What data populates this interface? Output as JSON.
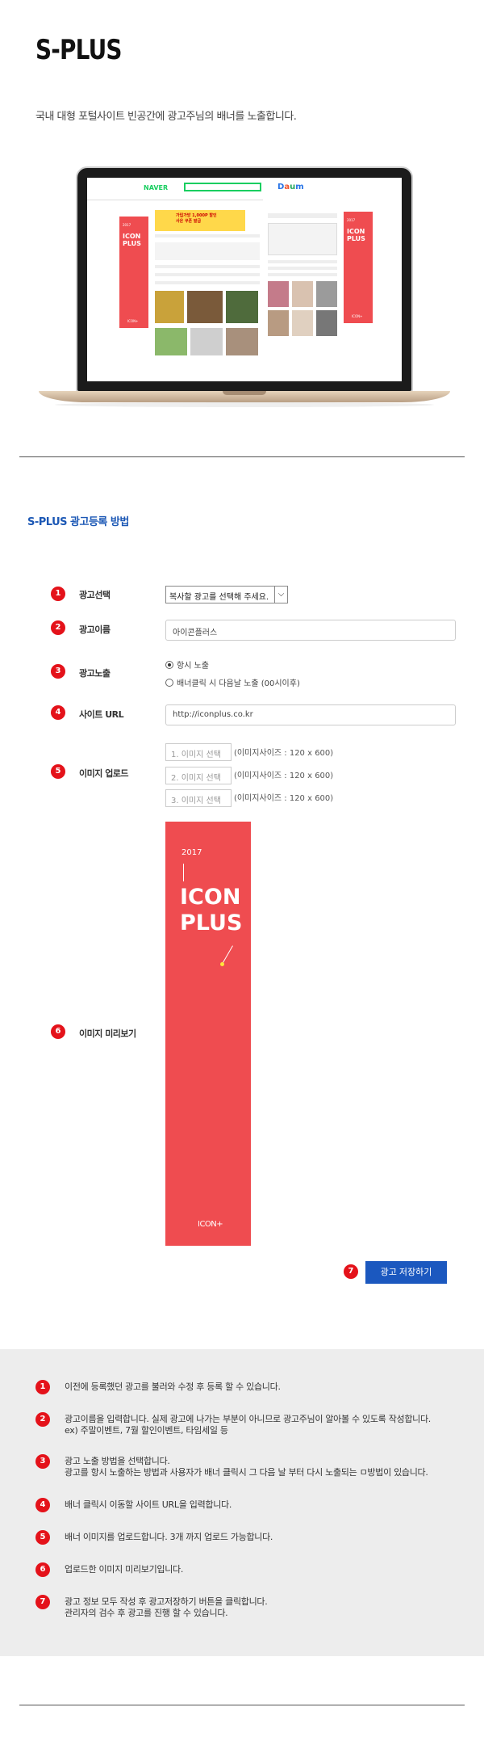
{
  "header": {
    "logo": "S-PLUS",
    "intro": "국내 대형 포털사이트 빈공간에 광고주님의 배너를 노출합니다."
  },
  "mockup": {
    "naver_logo": "NAVER",
    "daum_logo": [
      "D",
      "a",
      "u",
      "m"
    ],
    "banner_year": "2017",
    "banner_title_1": "ICON",
    "banner_title_2": "PLUS",
    "banner_footer": "ICON+",
    "ad_line_1": "가입가방 1,000P 할인",
    "ad_line_2": "사은 쿠폰 발급"
  },
  "section": {
    "title": "S-PLUS 광고등록 방법"
  },
  "form": {
    "ad_select": {
      "number": "1",
      "label": "광고선택",
      "value": "복사할 광고를 선택해 주세요."
    },
    "ad_name": {
      "number": "2",
      "label": "광고이름",
      "value": "아이콘플러스"
    },
    "ad_exposure": {
      "number": "3",
      "label": "광고노출",
      "options": [
        "항시 노출",
        "배너클릭 시 다음날 노출 (00시이후)"
      ]
    },
    "site_url": {
      "number": "4",
      "label": "사이트 URL",
      "value": "http://iconplus.co.kr"
    },
    "image_upload": {
      "number": "5",
      "label": "이미지 업로드",
      "buttons": [
        "1. 이미지 선택",
        "2. 이미지 선택",
        "3. 이미지 선택"
      ],
      "size_note": "(이미지사이즈 : 120 x 600)"
    },
    "image_preview": {
      "number": "6",
      "label": "이미지 미리보기",
      "year": "2017",
      "title_1": "ICON",
      "title_2": "PLUS",
      "brand": "ICON+"
    },
    "save": {
      "number": "7",
      "label": "광고 저장하기"
    }
  },
  "help": [
    {
      "number": "1",
      "lines": [
        "이전에 등록했던 광고를 불러와 수정 후 등록 할 수 있습니다."
      ]
    },
    {
      "number": "2",
      "lines": [
        "광고이름을 입력합니다. 실제 광고에 나가는 부분이 아니므로 광고주님이 알아볼 수 있도록 작성합니다.",
        "ex) 주말이벤트, 7월 할인이벤트, 타임세일 등"
      ]
    },
    {
      "number": "3",
      "lines": [
        "광고 노출 방법을 선택합니다.",
        "광고를 항시 노출하는 방법과 사용자가 배너 클릭시 그 다음 날 부터 다시 노출되는 ㅁ방법이 있습니다."
      ]
    },
    {
      "number": "4",
      "lines": [
        "배너 클릭시 이동할 사이트 URL을 입력합니다."
      ]
    },
    {
      "number": "5",
      "lines": [
        "배너 이미지를 업로드합니다. 3개 까지 업로드 가능합니다."
      ]
    },
    {
      "number": "6",
      "lines": [
        "업로드한 이미지 미리보기입니다."
      ]
    },
    {
      "number": "7",
      "lines": [
        "광고 정보 모두 작성 후 광고저장하기 버튼을 클릭합니다.",
        "관리자의 검수 후 광고를 진행 할 수 있습니다."
      ]
    }
  ]
}
